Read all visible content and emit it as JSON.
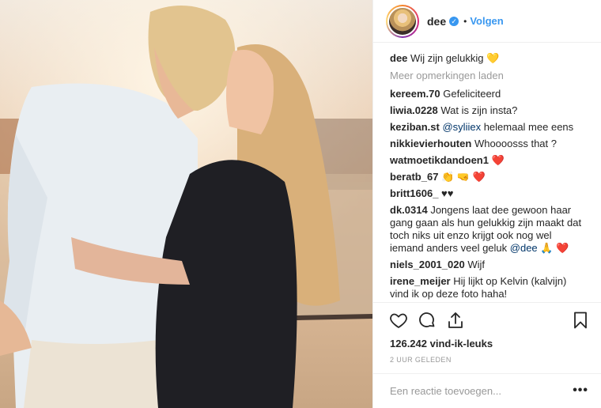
{
  "post": {
    "username": "dee",
    "verified_icon": "verified-badge-icon",
    "follow_label": "Volgen",
    "separator": "•",
    "caption_user": "dee",
    "caption_text": "Wij zijn gelukkig 💛"
  },
  "load_more_label": "Meer opmerkingen laden",
  "comments": [
    {
      "user": "kereem.70",
      "text": "Gefeliciteerd"
    },
    {
      "user": "liwia.0228",
      "text": "Wat is zijn insta?"
    },
    {
      "user": "keziban.st",
      "mention": "@syliiex",
      "text": " helemaal mee eens"
    },
    {
      "user": "nikkievierhouten",
      "text": "Whoooosss that ?"
    },
    {
      "user": "watmoetikdandoen1",
      "text": "❤️"
    },
    {
      "user": "beratb_67",
      "text": "👏 🤜 ❤️"
    },
    {
      "user": "britt1606_",
      "text": "♥♥"
    },
    {
      "user": "dk.0314",
      "text": "Jongens laat dee gewoon haar gang gaan als hun gelukkig zijn maakt dat toch niks uit enzo krijgt ook nog wel iemand anders veel geluk ",
      "mention2": "@dee",
      "tail": " 🙏 ❤️"
    },
    {
      "user": "niels_2001_020",
      "text": "Wijf"
    },
    {
      "user": "irene_meijer",
      "text": "Hij lijkt op Kelvin (kalvijn) vind ik op deze foto haha!"
    }
  ],
  "likes": "126.242 vind-ik-leuks",
  "timestamp": "2 UUR GELEDEN",
  "comment_input": {
    "placeholder": "Een reactie toevoegen...",
    "value": ""
  },
  "more_label": "•••",
  "colors": {
    "accent": "#3897f0",
    "text": "#262626",
    "muted": "#999999",
    "border": "#efefef"
  }
}
